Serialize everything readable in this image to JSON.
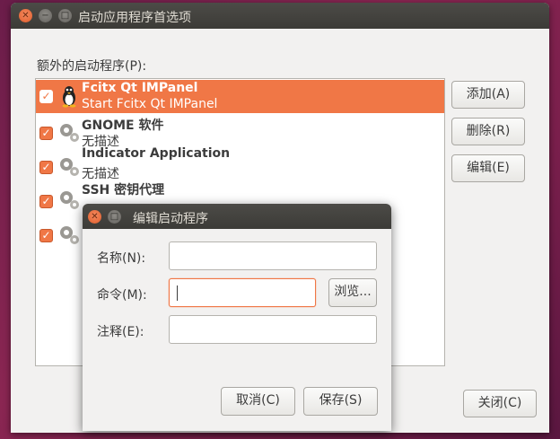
{
  "main_window": {
    "title": "启动应用程序首选项",
    "section_label": "额外的启动程序(P):",
    "items": [
      {
        "name": "Fcitx Qt IMPanel",
        "description": "Start Fcitx Qt IMPanel",
        "checked": true,
        "icon": "penguin-icon",
        "selected": true
      },
      {
        "name": "GNOME 软件",
        "description": "无描述",
        "checked": true,
        "icon": "gears-icon",
        "selected": false
      },
      {
        "name": "Indicator Application",
        "description": "无描述",
        "checked": true,
        "icon": "gears-icon",
        "selected": false
      },
      {
        "name": "SSH 密钥代理",
        "description": "",
        "checked": true,
        "icon": "gears-icon",
        "selected": false
      },
      {
        "name": "",
        "description": "",
        "checked": true,
        "icon": "gears-icon",
        "selected": false
      }
    ],
    "buttons": {
      "add": "添加(A)",
      "remove": "删除(R)",
      "edit": "编辑(E)",
      "close": "关闭(C)"
    }
  },
  "dialog": {
    "title": "编辑启动程序",
    "name_label": "名称(N):",
    "name_value": "",
    "command_label": "命令(M):",
    "command_value": "",
    "browse": "浏览...",
    "comment_label": "注释(E):",
    "comment_value": "",
    "cancel": "取消(C)",
    "save": "保存(S)"
  },
  "colors": {
    "accent": "#f07746",
    "titlebar": "#3c3b37",
    "window_bg": "#f2f1f0"
  }
}
